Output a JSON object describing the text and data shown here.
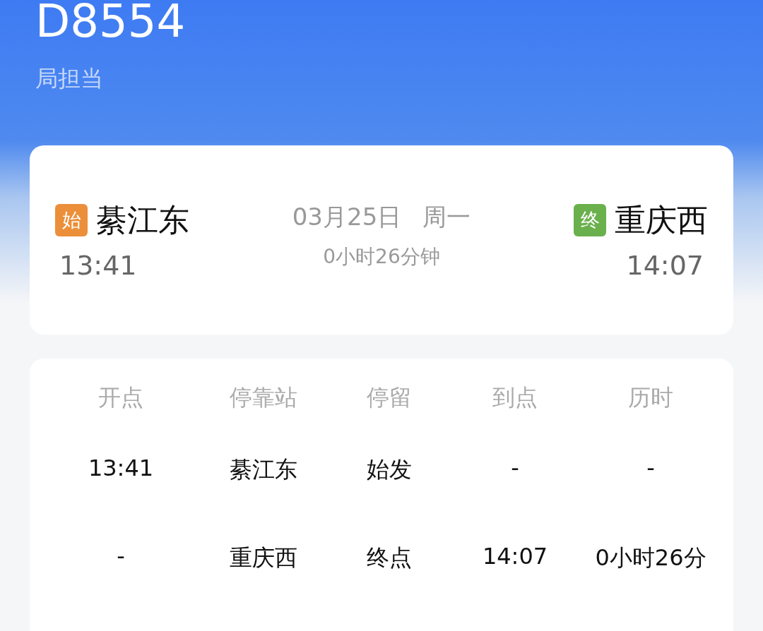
{
  "train": {
    "number": "D8554",
    "bureau": "局担当"
  },
  "journey": {
    "origin": {
      "badge": "始",
      "color": "#ec8f3a",
      "station": "綦江东",
      "time": "13:41"
    },
    "date": "03月25日",
    "weekday": "周一",
    "duration": "0小时26分钟",
    "destination": {
      "badge": "终",
      "color": "#6ab04c",
      "station": "重庆西",
      "time": "14:07"
    }
  },
  "stops": {
    "columns": [
      "开点",
      "停靠站",
      "停留",
      "到点",
      "历时"
    ],
    "rows": [
      [
        "13:41",
        "綦江东",
        "始发",
        "-",
        "-"
      ],
      [
        "-",
        "重庆西",
        "终点",
        "14:07",
        "0小时26分"
      ]
    ]
  }
}
